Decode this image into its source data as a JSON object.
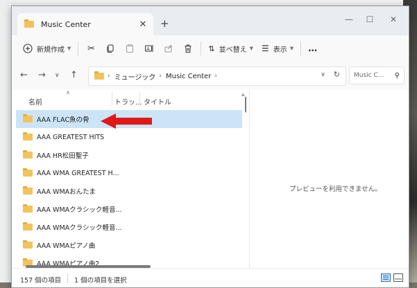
{
  "window": {
    "tab_title": "Music Center",
    "new_tab_label": "+",
    "tab_close": "✕",
    "controls": {
      "minimize": "—",
      "maximize": "☐",
      "close": "✕"
    }
  },
  "toolbar": {
    "new_label": "新規作成",
    "sort_label": "並べ替え",
    "view_label": "表示",
    "more_label": "…",
    "icons": [
      "plus-circle-icon",
      "cut-icon",
      "copy-icon",
      "paste-icon",
      "rename-icon",
      "share-icon",
      "delete-icon",
      "sort-icon",
      "view-icon",
      "more-icon"
    ]
  },
  "address": {
    "segments": [
      "ミュージック",
      "Music Center"
    ],
    "search_placeholder": "Music C..."
  },
  "columns": {
    "name": "名前",
    "track": "トラッ...",
    "title": "タイトル"
  },
  "files": [
    {
      "name": "AAA FLAC魚の骨",
      "selected": true
    },
    {
      "name": "AAA GREATEST HITS",
      "selected": false
    },
    {
      "name": "AAA HR松田聖子",
      "selected": false
    },
    {
      "name": "AAA WMA GREATEST H...",
      "selected": false
    },
    {
      "name": "AAA WMAおんたま",
      "selected": false
    },
    {
      "name": "AAA WMAクラシック軽音...",
      "selected": false
    },
    {
      "name": "AAA WMAクラシック軽音...",
      "selected": false
    },
    {
      "name": "AAA WMAピアノ曲",
      "selected": false
    },
    {
      "name": "AAA WMAピアノ曲2",
      "selected": false
    }
  ],
  "preview": {
    "message": "プレビューを利用できません。"
  },
  "status": {
    "item_count": "157 個の項目",
    "selection": "1 個の項目を選択"
  },
  "colors": {
    "accent": "#cce4f7",
    "arrow": "#e01818",
    "folder": "#f2c35b"
  }
}
